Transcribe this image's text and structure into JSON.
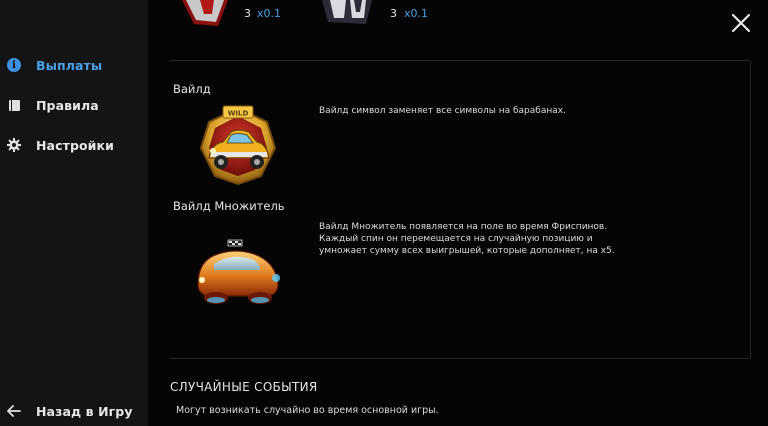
{
  "sidebar": {
    "items": [
      {
        "label": "Выплаты",
        "icon": "info-icon",
        "active": true
      },
      {
        "label": "Правила",
        "icon": "book-icon",
        "active": false
      },
      {
        "label": "Настройки",
        "icon": "gear-icon",
        "active": false
      }
    ],
    "back_label": "Назад в Игру"
  },
  "paytable_top": [
    {
      "count": "3",
      "multiplier": "x0.1"
    },
    {
      "count": "3",
      "multiplier": "x0.1"
    }
  ],
  "wild": {
    "title": "Вайлд",
    "badge_text": "WILD",
    "description": "Вайлд символ заменяет все символы на барабанах."
  },
  "wild_multiplier": {
    "title": "Вайлд Множитель",
    "description_lines": [
      "Вайлд Множитель появляется на поле во время Фриспинов.",
      "Каждый спин он перемещается на случайную позицию и",
      "умножает сумму всех выигрышей, которые дополняет, на x5."
    ]
  },
  "random_events": {
    "title": "СЛУЧАЙНЫЕ СОБЫТИЯ",
    "description": "Могут возникать случайно во время основной игры."
  },
  "colors": {
    "accent": "#4a9fe8",
    "sidebar_bg": "#141414",
    "main_bg": "#050505"
  }
}
